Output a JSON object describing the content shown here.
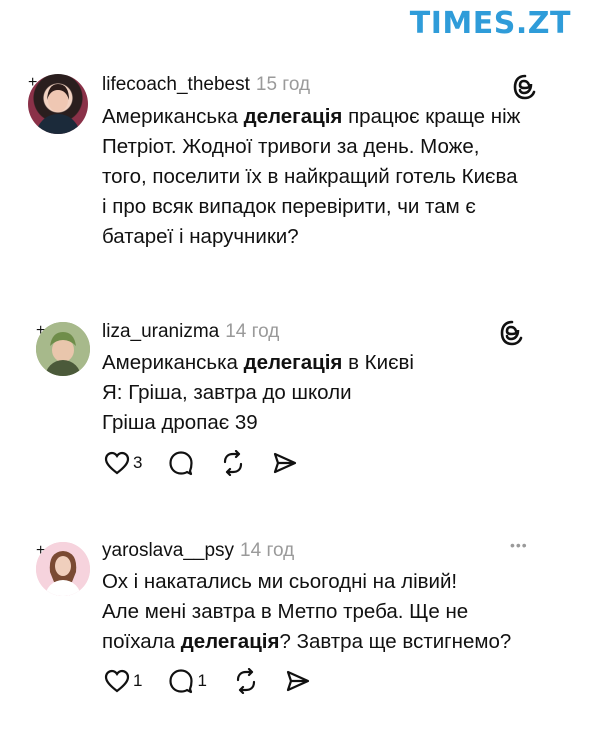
{
  "watermark": "TIMES.ZT",
  "posts": [
    {
      "username": "lifecoach_thebest",
      "time": "15 год",
      "lines": [
        {
          "pre": "Американська ",
          "bold": "делегація",
          "post": " працює краще ніж"
        },
        {
          "pre": "Петріот. Жодної тривоги за день. Може,",
          "bold": "",
          "post": ""
        },
        {
          "pre": "того, поселити їх в найкращий готель Києва",
          "bold": "",
          "post": ""
        },
        {
          "pre": "і про всяк випадок перевірити, чи там є",
          "bold": "",
          "post": ""
        },
        {
          "pre": "батареї і наручники?",
          "bold": "",
          "post": ""
        }
      ],
      "corner_icon": "threads-logo-icon"
    },
    {
      "username": "liza_uranizma",
      "time": "14 год",
      "lines": [
        {
          "pre": "Американська ",
          "bold": "делегація",
          "post": " в Києві"
        },
        {
          "pre": "Я: Гріша, завтра до школи",
          "bold": "",
          "post": ""
        },
        {
          "pre": "Гріша дропає 39",
          "bold": "",
          "post": ""
        }
      ],
      "corner_icon": "threads-logo-icon",
      "likes": "3"
    },
    {
      "username": "yaroslava__psy",
      "time": "14 год",
      "lines": [
        {
          "pre": "Ох і накатались ми сьогодні на лівий!",
          "bold": "",
          "post": ""
        },
        {
          "pre": "Але мені завтра в Метпо треба. Ще не",
          "bold": "",
          "post": ""
        },
        {
          "pre": "поїхала ",
          "bold": "делегація",
          "post": "? Завтра ще встигнемо?"
        }
      ],
      "corner_icon": "more-dots-icon",
      "likes": "1",
      "replies": "1"
    }
  ],
  "more_dots": "•••",
  "plus": "+",
  "colors": {
    "watermark": "#2f9cd9",
    "meta_time": "#9a9a9a"
  }
}
